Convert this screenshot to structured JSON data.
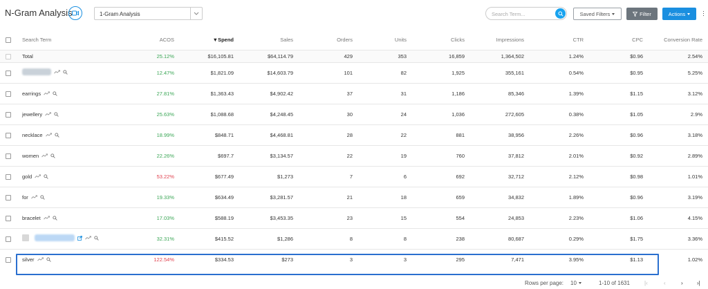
{
  "header": {
    "title": "N-Gram Analysis",
    "gram_select_value": "1-Gram Analysis",
    "search_placeholder": "Search Term...",
    "saved_filters_label": "Saved Filters",
    "filter_label": "Filter",
    "actions_label": "Actions"
  },
  "table": {
    "columns": {
      "search_term": "Search Term",
      "acos": "ACOS",
      "spend": "Spend",
      "sales": "Sales",
      "orders": "Orders",
      "units": "Units",
      "clicks": "Clicks",
      "impressions": "Impressions",
      "ctr": "CTR",
      "cpc": "CPC",
      "conversion_rate": "Conversion Rate"
    },
    "total": {
      "term": "Total",
      "acos": "25.12%",
      "spend": "$16,105.81",
      "sales": "$64,114.79",
      "orders": "429",
      "units": "353",
      "clicks": "16,859",
      "impressions": "1,364,502",
      "ctr": "1.24%",
      "cpc": "$0.96",
      "conversion_rate": "2.54%"
    },
    "rows": [
      {
        "term": "",
        "acos": "12.47%",
        "spend": "$1,821.09",
        "sales": "$14,603.79",
        "orders": "101",
        "units": "82",
        "clicks": "1,925",
        "impressions": "355,161",
        "ctr": "0.54%",
        "cpc": "$0.95",
        "conversion_rate": "5.25%"
      },
      {
        "term": "earrings",
        "acos": "27.81%",
        "spend": "$1,363.43",
        "sales": "$4,902.42",
        "orders": "37",
        "units": "31",
        "clicks": "1,186",
        "impressions": "85,346",
        "ctr": "1.39%",
        "cpc": "$1.15",
        "conversion_rate": "3.12%"
      },
      {
        "term": "jewellery",
        "acos": "25.63%",
        "spend": "$1,088.68",
        "sales": "$4,248.45",
        "orders": "30",
        "units": "24",
        "clicks": "1,036",
        "impressions": "272,605",
        "ctr": "0.38%",
        "cpc": "$1.05",
        "conversion_rate": "2.9%"
      },
      {
        "term": "necklace",
        "acos": "18.99%",
        "spend": "$848.71",
        "sales": "$4,468.81",
        "orders": "28",
        "units": "22",
        "clicks": "881",
        "impressions": "38,956",
        "ctr": "2.26%",
        "cpc": "$0.96",
        "conversion_rate": "3.18%"
      },
      {
        "term": "women",
        "acos": "22.26%",
        "spend": "$697.7",
        "sales": "$3,134.57",
        "orders": "22",
        "units": "19",
        "clicks": "760",
        "impressions": "37,812",
        "ctr": "2.01%",
        "cpc": "$0.92",
        "conversion_rate": "2.89%"
      },
      {
        "term": "gold",
        "acos": "53.22%",
        "spend": "$677.49",
        "sales": "$1,273",
        "orders": "7",
        "units": "6",
        "clicks": "692",
        "impressions": "32,712",
        "ctr": "2.12%",
        "cpc": "$0.98",
        "conversion_rate": "1.01%"
      },
      {
        "term": "for",
        "acos": "19.33%",
        "spend": "$634.49",
        "sales": "$3,281.57",
        "orders": "21",
        "units": "18",
        "clicks": "659",
        "impressions": "34,832",
        "ctr": "1.89%",
        "cpc": "$0.96",
        "conversion_rate": "3.19%"
      },
      {
        "term": "bracelet",
        "acos": "17.03%",
        "spend": "$588.19",
        "sales": "$3,453.35",
        "orders": "23",
        "units": "15",
        "clicks": "554",
        "impressions": "24,853",
        "ctr": "2.23%",
        "cpc": "$1.06",
        "conversion_rate": "4.15%"
      },
      {
        "term": "",
        "acos": "32.31%",
        "spend": "$415.52",
        "sales": "$1,286",
        "orders": "8",
        "units": "8",
        "clicks": "238",
        "impressions": "80,687",
        "ctr": "0.29%",
        "cpc": "$1.75",
        "conversion_rate": "3.36%"
      },
      {
        "term": "silver",
        "acos": "122.54%",
        "spend": "$334.53",
        "sales": "$273",
        "orders": "3",
        "units": "3",
        "clicks": "295",
        "impressions": "7,471",
        "ctr": "3.95%",
        "cpc": "$1.13",
        "conversion_rate": "1.02%"
      }
    ]
  },
  "pagination": {
    "rows_per_page_label": "Rows per page:",
    "rows_per_page_value": "10",
    "range_text": "1-10 of 1631"
  },
  "colors": {
    "accent": "#1a8fe0",
    "acos_good": "#3aa655",
    "acos_bad": "#e0424f",
    "highlight_border": "#2a6fcf"
  }
}
